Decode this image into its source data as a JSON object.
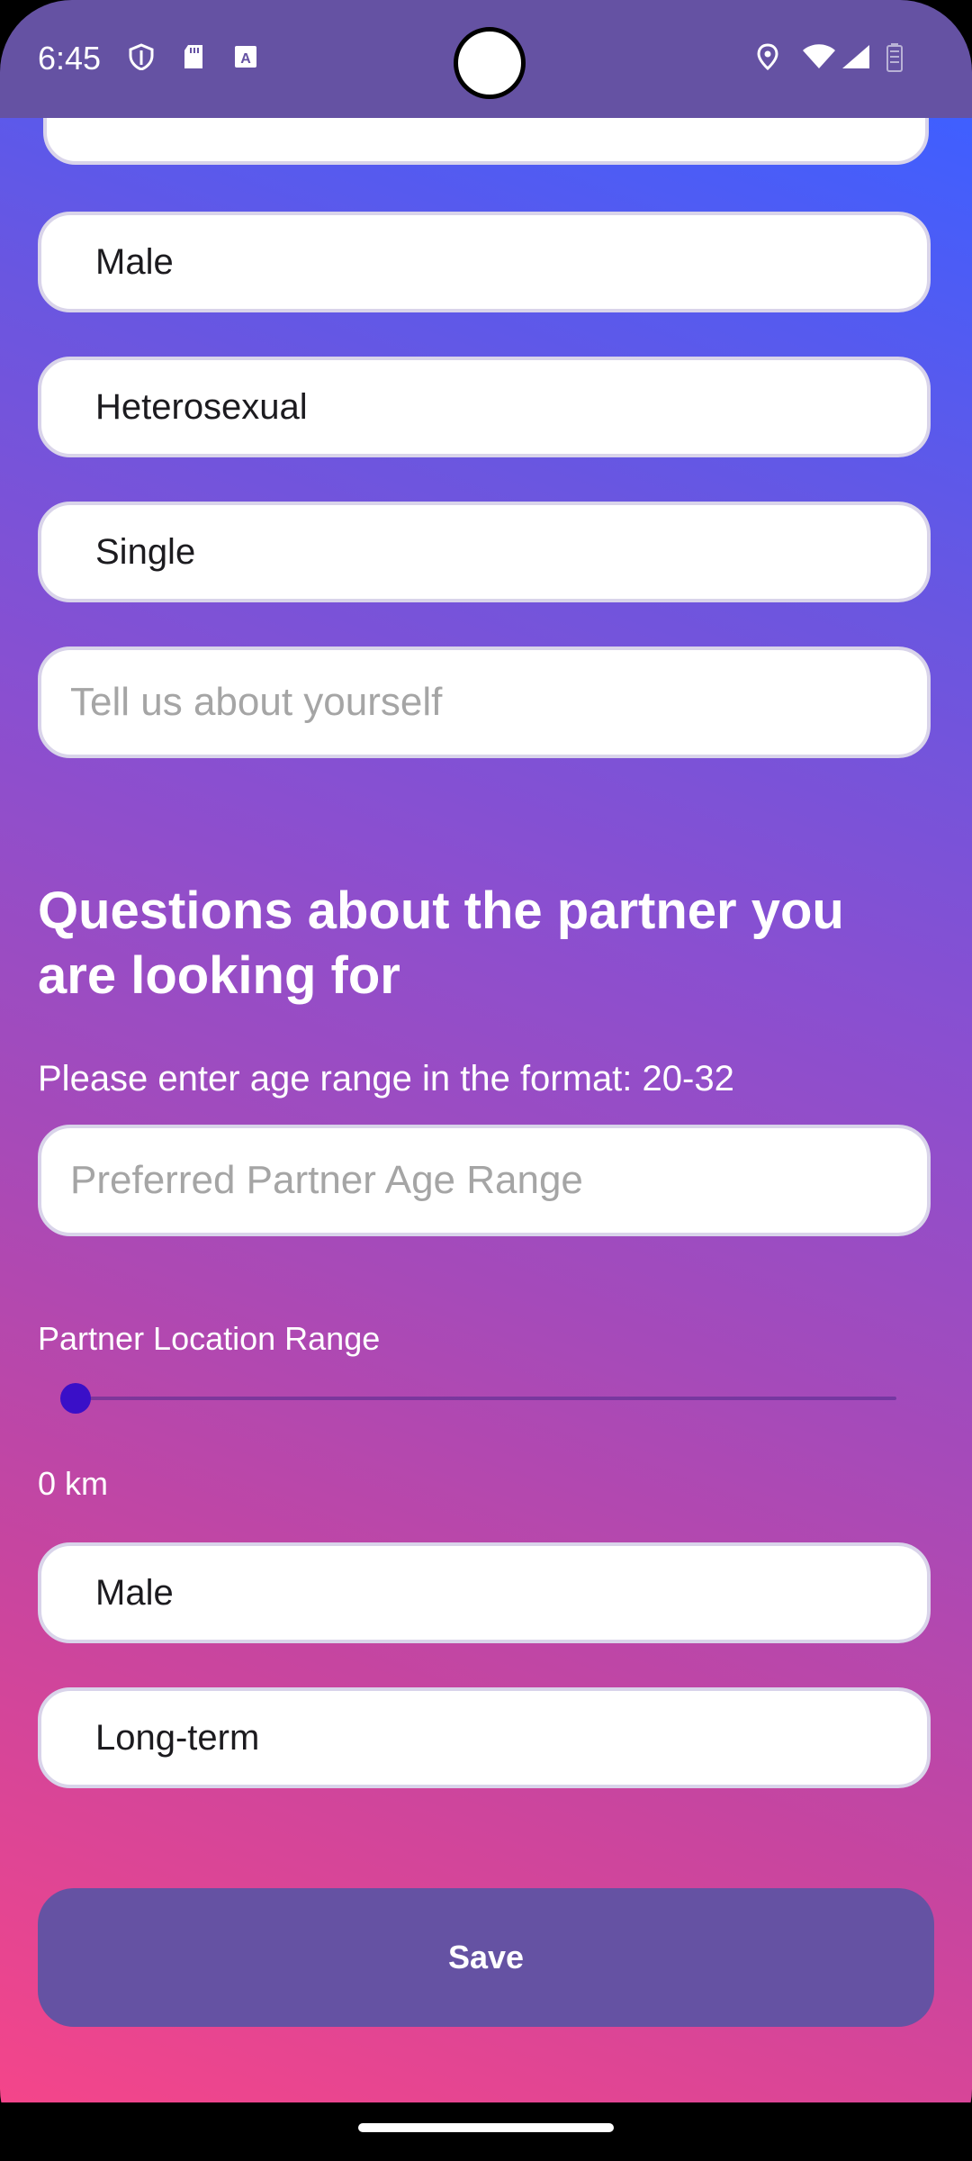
{
  "status_bar": {
    "time": "6:45",
    "left_icons": [
      "shield-icon",
      "sd-card-icon",
      "font-icon"
    ],
    "right_icons": [
      "location-icon",
      "wifi-icon",
      "signal-icon",
      "battery-icon"
    ]
  },
  "profile": {
    "gender": "Male",
    "orientation": "Heterosexual",
    "relationship_status": "Single",
    "about": {
      "value": "",
      "placeholder": "Tell us about yourself"
    }
  },
  "partner": {
    "section_title": "Questions about the partner you are looking for",
    "age_hint": "Please enter age range in the format: 20-32",
    "age_range": {
      "value": "",
      "placeholder": "Preferred Partner Age Range"
    },
    "location_label": "Partner Location Range",
    "location_value": "0 km",
    "location_slider_fraction": 0,
    "gender": "Male",
    "relationship_type": "Long-term"
  },
  "actions": {
    "save_label": "Save"
  },
  "colors": {
    "status_bar": "#6552a3",
    "button": "#6552a3",
    "gradient_top": "#3f5fff",
    "gradient_bottom": "#f4458a",
    "slider_thumb": "#3a0fc8"
  }
}
